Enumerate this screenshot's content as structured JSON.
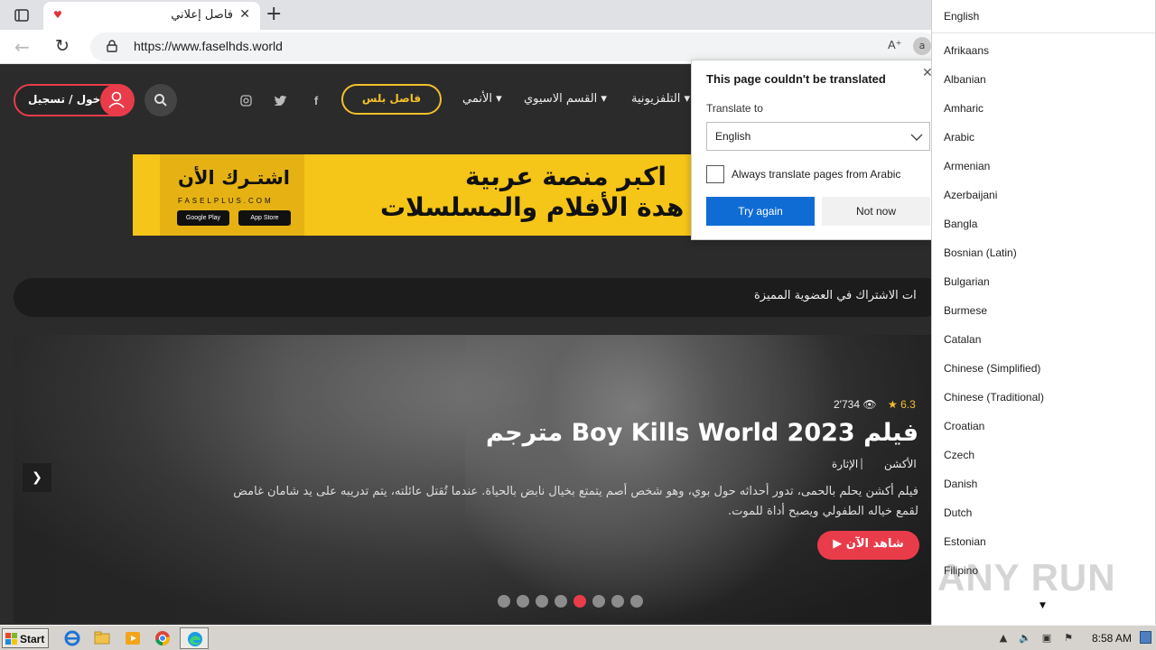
{
  "browser": {
    "tab_title": "فاصل إعلاني",
    "url": "https://www.faselhds.world",
    "read_aloud_icon": "read-aloud-icon"
  },
  "site": {
    "login_label": "دخول / تسجيل",
    "plus_label": "فاصل بلس",
    "nav": [
      "الأنمي",
      "القسم الاسيوي",
      "التلفزيونية"
    ],
    "ticker_text": "ات الاشتراك في العضوية المميزة"
  },
  "banner": {
    "subscribe": "اشتـرك الأن",
    "brand": "FASELPLUS.COM",
    "google_play": "Google Play",
    "app_store": "App Store",
    "headline1": "اكبر منصة عربية",
    "headline2": "هدة الأفلام والمسلسلات"
  },
  "hero": {
    "rating": "6.3",
    "views": "2'734",
    "title": "فيلم Boy Kills World 2023 مترجم",
    "genre1": "الأكشن",
    "genre2": "الإثارة",
    "description": "فيلم أكشن يحلم بالحمى، تدور أحداثه حول بوي، وهو شخص أصم يتمتع بخيال نابض بالحياة. عندما تُقتل عائلته، يتم تدريبه على يد شامان غامض لقمع خياله الطفولي ويصبح أداة للموت.",
    "watch_label": "شاهد الآن",
    "active_slide": 5,
    "slide_count": 8
  },
  "translate_popup": {
    "heading": "This page couldn't be translated",
    "translate_to_label": "Translate to",
    "selected_language": "English",
    "always_label": "Always translate pages from Arabic",
    "try_again": "Try again",
    "not_now": "Not now"
  },
  "language_list": {
    "selected": "English",
    "items": [
      "Afrikaans",
      "Albanian",
      "Amharic",
      "Arabic",
      "Armenian",
      "Azerbaijani",
      "Bangla",
      "Bosnian (Latin)",
      "Bulgarian",
      "Burmese",
      "Catalan",
      "Chinese (Simplified)",
      "Chinese (Traditional)",
      "Croatian",
      "Czech",
      "Danish",
      "Dutch",
      "Estonian",
      "Filipino"
    ]
  },
  "watermark": "ANY RUN",
  "taskbar": {
    "start_label": "Start",
    "clock": "8:58 AM"
  },
  "colors": {
    "accent_red": "#e93c4a",
    "accent_gold": "#f2c02a",
    "edge_blue": "#0f6cd5"
  }
}
